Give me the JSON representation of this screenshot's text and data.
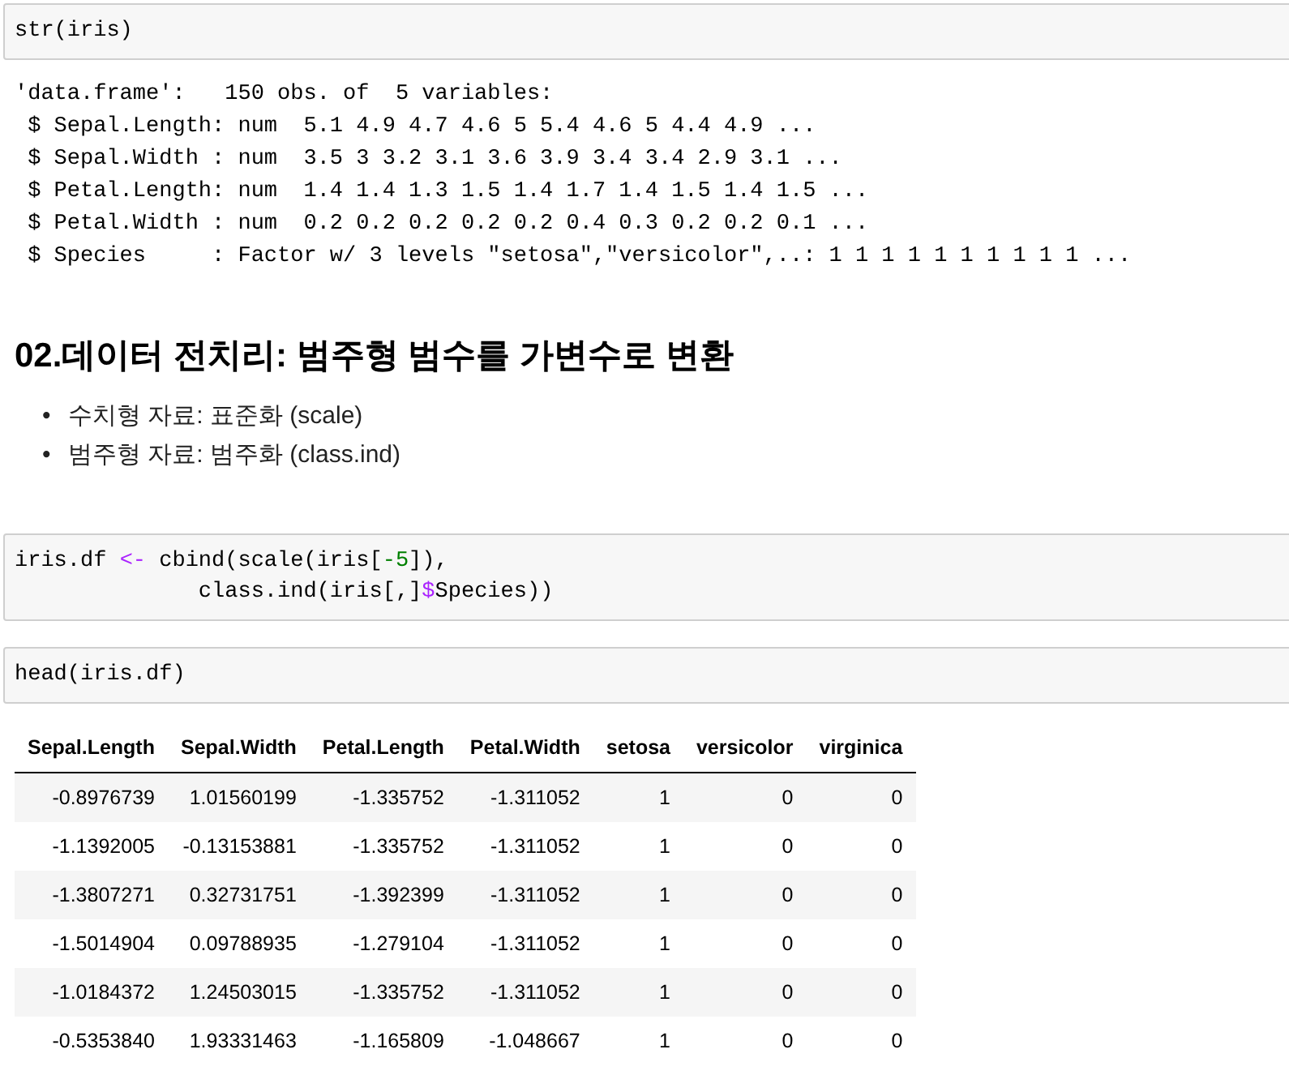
{
  "cells": [
    {
      "kind": "code",
      "lines": [
        [
          {
            "kind": "plain",
            "text": "str(iris)"
          }
        ]
      ],
      "output": {
        "kind": "text",
        "lines": [
          "'data.frame':\t150 obs. of  5 variables:",
          " $ Sepal.Length: num  5.1 4.9 4.7 4.6 5 5.4 4.6 5 4.4 4.9 ...",
          " $ Sepal.Width : num  3.5 3 3.2 3.1 3.6 3.9 3.4 3.4 2.9 3.1 ...",
          " $ Petal.Length: num  1.4 1.4 1.3 1.5 1.4 1.7 1.4 1.5 1.4 1.5 ...",
          " $ Petal.Width : num  0.2 0.2 0.2 0.2 0.2 0.4 0.3 0.2 0.2 0.1 ...",
          " $ Species     : Factor w/ 3 levels \"setosa\",\"versicolor\",..: 1 1 1 1 1 1 1 1 1 1 ..."
        ]
      }
    },
    {
      "kind": "markdown",
      "heading": "02.데이터 전치리: 범주형 범수를 가변수로 변환",
      "bullets": [
        {
          "marker": "•",
          "text": "수치형 자료: 표준화 (scale)"
        },
        {
          "marker": "•",
          "text": "범주형 자료: 범주화 (class.ind)"
        }
      ]
    },
    {
      "kind": "code",
      "lines": [
        [
          {
            "kind": "plain",
            "text": "iris.df "
          },
          {
            "kind": "operator",
            "text": "<-"
          },
          {
            "kind": "plain",
            "text": " cbind(scale(iris["
          },
          {
            "kind": "number",
            "text": "-5"
          },
          {
            "kind": "plain",
            "text": "]),"
          }
        ],
        [
          {
            "kind": "plain",
            "text": "              class.ind(iris[,]"
          },
          {
            "kind": "operator",
            "text": "$"
          },
          {
            "kind": "plain",
            "text": "Species))"
          }
        ]
      ]
    },
    {
      "kind": "code",
      "lines": [
        [
          {
            "kind": "plain",
            "text": "head(iris.df)"
          }
        ]
      ],
      "output": {
        "kind": "table",
        "columns": [
          "Sepal.Length",
          "Sepal.Width",
          "Petal.Length",
          "Petal.Width",
          "setosa",
          "versicolor",
          "virginica"
        ],
        "rows": [
          [
            "-0.8976739",
            "1.01560199",
            "-1.335752",
            "-1.311052",
            "1",
            "0",
            "0"
          ],
          [
            "-1.1392005",
            "-0.13153881",
            "-1.335752",
            "-1.311052",
            "1",
            "0",
            "0"
          ],
          [
            "-1.3807271",
            "0.32731751",
            "-1.392399",
            "-1.311052",
            "1",
            "0",
            "0"
          ],
          [
            "-1.5014904",
            "0.09788935",
            "-1.279104",
            "-1.311052",
            "1",
            "0",
            "0"
          ],
          [
            "-1.0184372",
            "1.24503015",
            "-1.335752",
            "-1.311052",
            "1",
            "0",
            "0"
          ],
          [
            "-0.5353840",
            "1.93331463",
            "-1.165809",
            "-1.048667",
            "1",
            "0",
            "0"
          ]
        ]
      }
    }
  ]
}
